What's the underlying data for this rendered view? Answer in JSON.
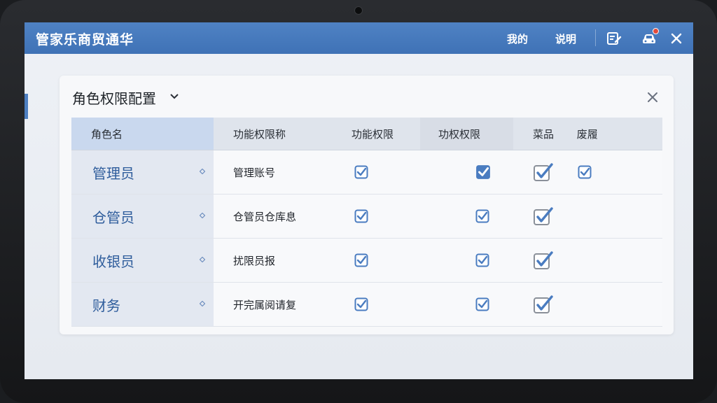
{
  "app": {
    "title": "管家乐商贸通华",
    "links": [
      "我的",
      "说明"
    ],
    "accent_color": "#4578bc"
  },
  "panel": {
    "title": "角色权限配置",
    "columns": [
      "角色名",
      "功能权限称",
      "功能权限",
      "功权权限",
      "菜品",
      "废履"
    ],
    "rows": [
      {
        "role": "管理员",
        "function": "管理账号",
        "perm1": true,
        "perm2": true,
        "perm2_style": "filled",
        "perm3": true,
        "perm4": true
      },
      {
        "role": "仓管员",
        "function": "仓管员仓库息",
        "perm1": true,
        "perm2": true,
        "perm2_style": "outline",
        "perm3": true,
        "perm4": false
      },
      {
        "role": "收银员",
        "function": "扰限员报",
        "perm1": true,
        "perm2": true,
        "perm2_style": "outline",
        "perm3": true,
        "perm4": false
      },
      {
        "role": "财务",
        "function": "开完属阅请复",
        "perm1": true,
        "perm2": true,
        "perm2_style": "outline",
        "perm3": true,
        "perm4": false
      }
    ]
  }
}
